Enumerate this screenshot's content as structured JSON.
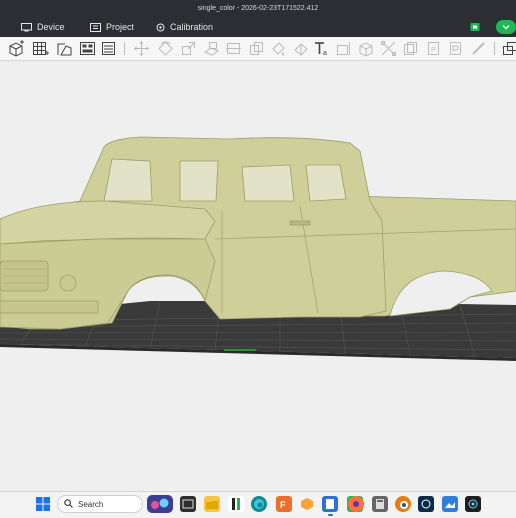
{
  "window": {
    "title": "single_color - 2026-02-23T171522.412"
  },
  "nav": {
    "device_label": "Device",
    "project_label": "Project",
    "calibration_label": "Calibration"
  },
  "toolbar": {
    "tools": [
      "add-object",
      "add-plate",
      "orient",
      "arrange",
      "split-objects",
      "move",
      "rotate",
      "scale",
      "lay-on-face",
      "cut",
      "boolean",
      "support-paint",
      "seam-paint",
      "text",
      "variable-layer-height",
      "assembly",
      "measure",
      "mesh-boolean",
      "color-paint",
      "fuzzy-skin",
      "brim-ears",
      "more"
    ]
  },
  "taskbar": {
    "search_label": "Search",
    "apps": [
      "start",
      "search",
      "widgets",
      "file-explorer",
      "bambu-studio",
      "edge",
      "fusion",
      "3d-viewer",
      "notepad",
      "green-app",
      "firefox",
      "calculator",
      "blender",
      "terminal-app",
      "photos",
      "monitor-app"
    ]
  },
  "colors": {
    "title_bar": "#2b2e33",
    "accent": "#1db954",
    "model": "#cfcf9a",
    "plate": "#3c3c3c",
    "viewport_bg": "#efefef"
  }
}
